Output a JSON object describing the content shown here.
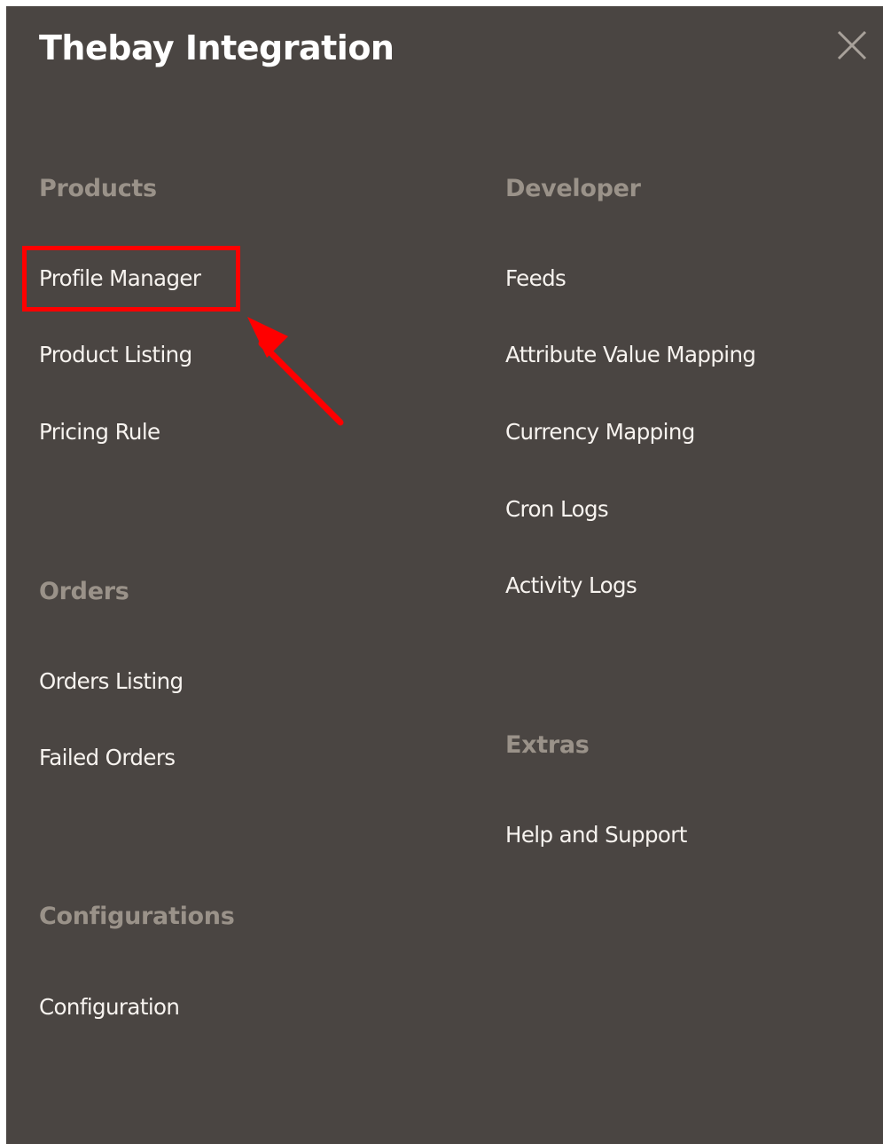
{
  "header": {
    "title": "Thebay Integration",
    "close_icon": "close-icon"
  },
  "sections": {
    "products": {
      "heading": "Products",
      "items": [
        "Profile Manager",
        "Product Listing",
        "Pricing Rule"
      ]
    },
    "orders": {
      "heading": "Orders",
      "items": [
        "Orders Listing",
        "Failed Orders"
      ]
    },
    "configurations": {
      "heading": "Configurations",
      "items": [
        "Configuration"
      ]
    },
    "developer": {
      "heading": "Developer",
      "items": [
        "Feeds",
        "Attribute Value Mapping",
        "Currency Mapping",
        "Cron Logs",
        "Activity Logs"
      ]
    },
    "extras": {
      "heading": "Extras",
      "items": [
        "Help and Support"
      ]
    }
  },
  "annotation": {
    "highlighted_item": "Profile Manager",
    "color": "#ff0000"
  },
  "colors": {
    "panel_background": "#4a4542",
    "heading_text": "#9a9289",
    "link_text": "#f7f3ef"
  }
}
